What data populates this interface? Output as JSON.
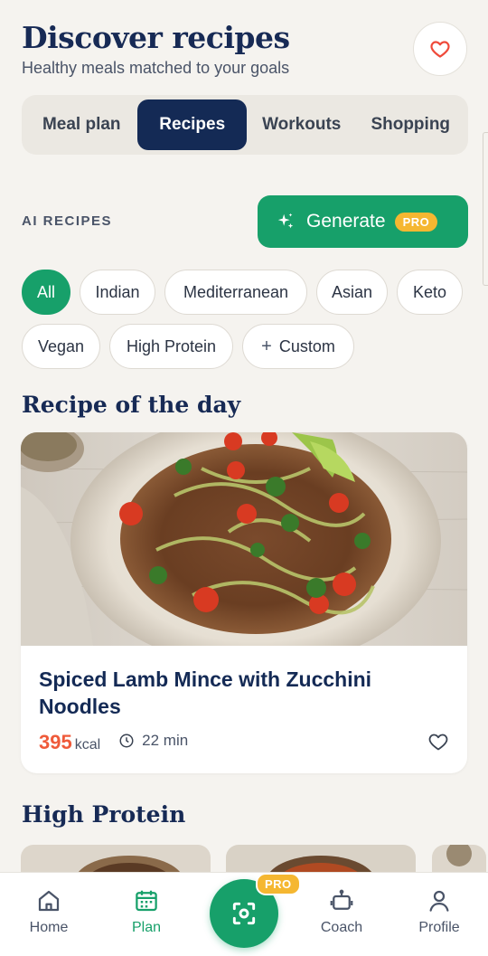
{
  "header": {
    "title": "Discover recipes",
    "subtitle": "Healthy meals matched to your goals"
  },
  "tabs": [
    {
      "label": "Meal plan",
      "active": false
    },
    {
      "label": "Recipes",
      "active": true
    },
    {
      "label": "Workouts",
      "active": false
    },
    {
      "label": "Shopping",
      "active": false
    }
  ],
  "ai": {
    "label": "AI RECIPES",
    "generate_label": "Generate",
    "pro_badge": "PRO"
  },
  "filters": {
    "row1": [
      "All",
      "Indian",
      "Mediterranean",
      "Asian",
      "Keto"
    ],
    "row2": [
      "Vegan",
      "High Protein",
      "Custom"
    ],
    "active": "All"
  },
  "recipe_of_day": {
    "section_title": "Recipe of the day",
    "title": "Spiced Lamb Mince with Zucchini Noodles",
    "kcal": "395",
    "kcal_unit": "kcal",
    "time": "22 min"
  },
  "high_protein": {
    "section_title": "High Protein"
  },
  "nav": {
    "home": "Home",
    "plan": "Plan",
    "scan_pro": "PRO",
    "coach": "Coach",
    "profile": "Profile",
    "active": "Plan"
  },
  "colors": {
    "accent": "#17a06a",
    "navy": "#142a55",
    "pro": "#f5b731",
    "kcal": "#ef5a3a",
    "heart": "#ef4a3a"
  }
}
